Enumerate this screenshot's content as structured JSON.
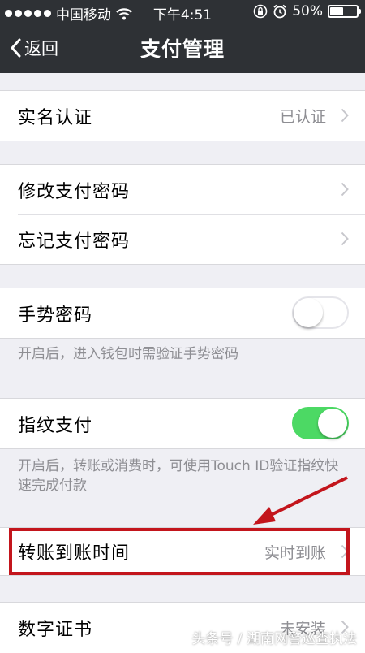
{
  "status_bar": {
    "carrier": "中国移动",
    "time": "下午4:51",
    "battery": "50%",
    "battery_level": 0.5
  },
  "nav": {
    "back_label": "返回",
    "title": "支付管理"
  },
  "rows": {
    "realname": {
      "label": "实名认证",
      "value": "已认证"
    },
    "change_pwd": {
      "label": "修改支付密码"
    },
    "forgot_pwd": {
      "label": "忘记支付密码"
    },
    "gesture": {
      "label": "手势密码",
      "enabled": false,
      "hint": "开启后，进入钱包时需验证手势密码"
    },
    "fingerprint": {
      "label": "指纹支付",
      "enabled": true,
      "hint": "开启后，转账或消费时，可使用Touch ID验证指纹快速完成付款"
    },
    "transfer_time": {
      "label": "转账到账时间",
      "value": "实时到账"
    },
    "certificate": {
      "label": "数字证书",
      "value": "未安装"
    }
  },
  "watermark": "头条号 / 湖南网警巡查执法",
  "colors": {
    "nav_bg": "#2e3135",
    "toggle_on": "#4cd964",
    "highlight": "#c3151c"
  }
}
